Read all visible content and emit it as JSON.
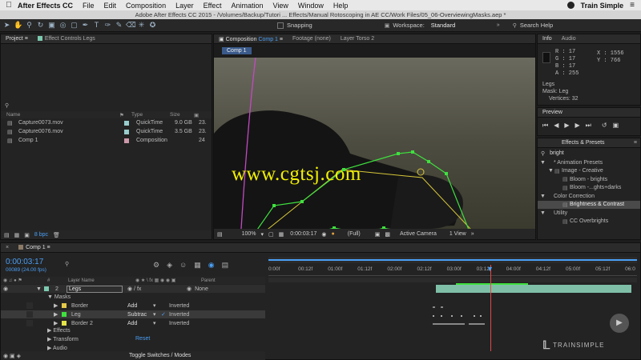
{
  "menubar": {
    "app_name": "After Effects CC",
    "items": [
      "File",
      "Edit",
      "Composition",
      "Layer",
      "Effect",
      "Animation",
      "View",
      "Window",
      "Help"
    ],
    "brand": "Train Simple"
  },
  "titlebar": "Adobe After Effects CC 2015 - /Volumes/Backup/Tutori ... Effects/Manual Rotoscoping in AE CC/Work Files/05_06-OverviewingMasks.aep *",
  "toolbar": {
    "snapping_label": "Snapping",
    "workspace_label": "Workspace:",
    "workspace_value": "Standard",
    "search_placeholder": "Search Help"
  },
  "project": {
    "tabs": [
      "Project",
      "Effect Controls Legs"
    ],
    "columns": [
      "Name",
      "Type",
      "Size",
      "Frame"
    ],
    "items": [
      {
        "name": "Capture0073.mov",
        "type": "QuickTime",
        "size": "9.0 GB",
        "fr": "23."
      },
      {
        "name": "Capture0076.mov",
        "type": "QuickTime",
        "size": "3.5 GB",
        "fr": "23."
      },
      {
        "name": "Comp 1",
        "type": "Composition",
        "size": "",
        "fr": "24"
      }
    ],
    "bpc": "8 bpc"
  },
  "composition": {
    "tabs": [
      "Composition Comp 1",
      "Footage (none)",
      "Layer Torso 2"
    ],
    "comp_tab_prefix": "Composition",
    "comp_tab_name": "Comp 1",
    "breadcrumb": "Comp 1",
    "watermark": "www.cgtsj.com",
    "zoom": "100%",
    "timecode": "0:00:03:17",
    "resolution": "(Full)",
    "camera": "Active Camera",
    "views": "1 View"
  },
  "info": {
    "tabs": [
      "Info",
      "Audio"
    ],
    "r": "R : 17",
    "g": "G : 17",
    "b": "B : 17",
    "a": "A : 255",
    "x": "X : 1556",
    "y": "Y : 766",
    "layer_name": "Legs",
    "mask_line": "Mask: Leg",
    "vertices_line": "Vertices: 32"
  },
  "preview": {
    "title": "Preview"
  },
  "effects": {
    "title": "Effects & Presets",
    "search_value": "bright",
    "tree": [
      {
        "label": "* Animation Presets",
        "level": 0,
        "arrow": "▼"
      },
      {
        "label": "Image - Creative",
        "level": 1,
        "arrow": "▼"
      },
      {
        "label": "Bloom - brights",
        "level": 2,
        "arrow": ""
      },
      {
        "label": "Bloom -...ghts+darks",
        "level": 2,
        "arrow": ""
      },
      {
        "label": "Color Correction",
        "level": 0,
        "arrow": "▼"
      },
      {
        "label": "Brightness & Contrast",
        "level": 2,
        "arrow": "",
        "selected": true
      },
      {
        "label": "Utility",
        "level": 0,
        "arrow": "▼"
      },
      {
        "label": "CC Overbrights",
        "level": 2,
        "arrow": ""
      }
    ]
  },
  "timeline": {
    "tab": "Comp 1",
    "timecode": "0:00:03:17",
    "frame_info": "00089 (24.00 fps)",
    "col_layer_name": "Layer Name",
    "col_parent": "Parent",
    "ruler": [
      "0:00f",
      "00:12f",
      "01:00f",
      "01:12f",
      "02:00f",
      "02:12f",
      "03:00f",
      "03:12f",
      "04:00f",
      "04:12f",
      "05:00f",
      "05:12f",
      "06:0"
    ],
    "layer": {
      "num": "2",
      "name": "Legs",
      "parent": "None"
    },
    "masks_label": "Masks",
    "masks": [
      {
        "name": "Border",
        "mode": "Add",
        "inverted": "Inverted",
        "checked": false,
        "color": "#e3c84a"
      },
      {
        "name": "Leg",
        "mode": "Subtrac",
        "inverted": "Inverted",
        "checked": true,
        "color": "#3fe03f"
      },
      {
        "name": "Border 2",
        "mode": "Add",
        "inverted": "Inverted",
        "checked": false,
        "color": "#e3e34a"
      }
    ],
    "effects_label": "Effects",
    "transform_label": "Transform",
    "transform_reset": "Reset",
    "audio_label": "Audio",
    "toggle_label": "Toggle Switches / Modes",
    "trainsimple_logo": "TRAINSIMPLE"
  },
  "colors": {
    "accent_blue": "#4a9ff5",
    "mask_green": "#3fe03f",
    "mask_yellow": "#d8c83a",
    "playhead": "#e04a4a"
  }
}
